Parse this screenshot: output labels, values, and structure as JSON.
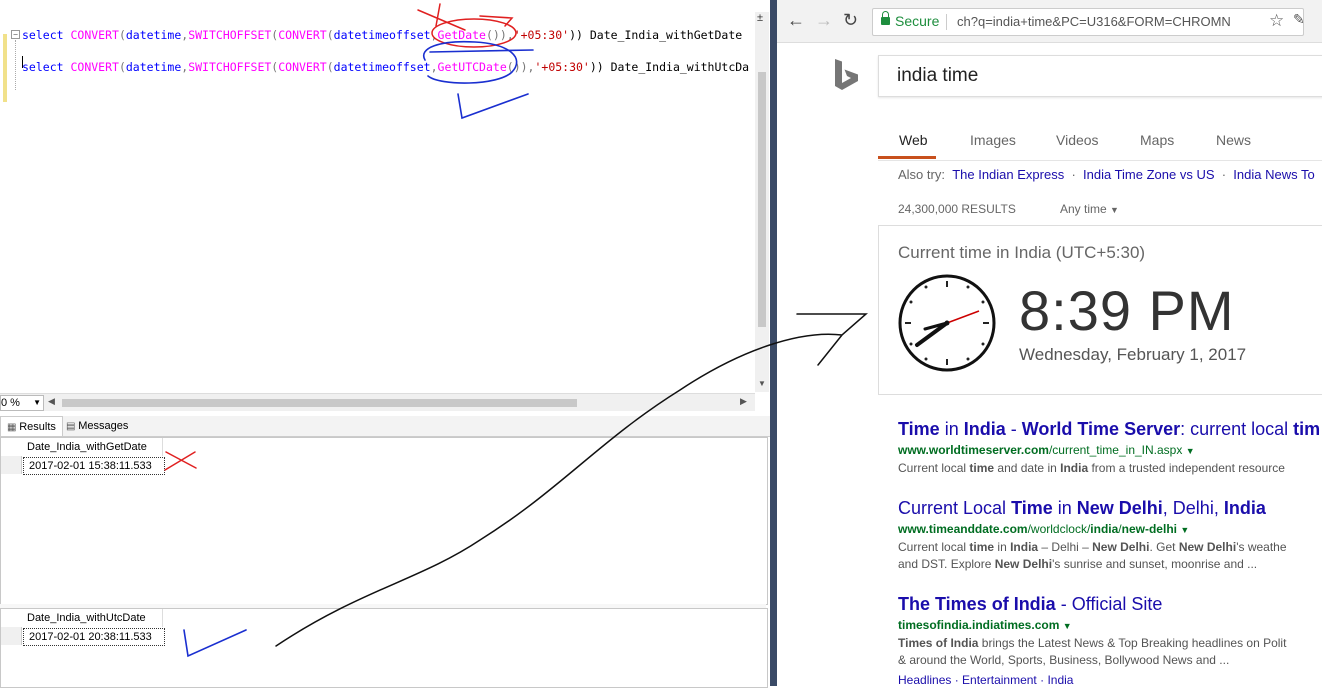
{
  "editor": {
    "line1": {
      "p1": "select ",
      "p2": "CONVERT",
      "p3": "(",
      "p4": "datetime",
      "p5": ",",
      "p6": "SWITCHOFFSET",
      "p7": "(",
      "p8": "CONVERT",
      "p9": "(",
      "p10": "datetimeoffset",
      "p11": ",",
      "p12": "GetDate",
      "p13": "()),",
      "p14": "'+05:30'",
      "p15": ")) Date_India_withGetDate"
    },
    "line2": {
      "p1": "select ",
      "p2": "CONVERT",
      "p3": "(",
      "p4": "datetime",
      "p5": ",",
      "p6": "SWITCHOFFSET",
      "p7": "(",
      "p8": "CONVERT",
      "p9": "(",
      "p10": "datetimeoffset",
      "p11": ",",
      "p12": "GetUTCDate",
      "p13": "()),",
      "p14": "'+05:30'",
      "p15": ")) Date_India_withUtcDa"
    },
    "zoom": "0 %"
  },
  "results": {
    "tabs": [
      "Results",
      "Messages"
    ],
    "grid1": {
      "header": "Date_India_withGetDate",
      "value": "2017-02-01 15:38:11.533"
    },
    "grid2": {
      "header": "Date_India_withUtcDate",
      "value": "2017-02-01 20:38:11.533"
    }
  },
  "browser": {
    "secure_label": "Secure",
    "url": "ch?q=india+time&PC=U316&FORM=CHROMN",
    "search_query": "india time",
    "scopes": [
      "Web",
      "Images",
      "Videos",
      "Maps",
      "News"
    ],
    "also_try_label": "Also try:",
    "also_try": [
      "The Indian Express",
      "India Time Zone vs US",
      "India News To"
    ],
    "result_count": "24,300,000 RESULTS",
    "any_time": "Any time",
    "time_card": {
      "title": "Current time in India (UTC+5:30)",
      "time": "8:39 PM",
      "date": "Wednesday, February 1, 2017"
    },
    "results": [
      {
        "title_parts": [
          "Time",
          " in ",
          "India",
          " - ",
          "World Time Server",
          ": current local ",
          "tim"
        ],
        "url_parts": [
          "www.worldtimeserver.com",
          "/current_time_in_IN.aspx"
        ],
        "desc1_parts": [
          "Current local ",
          "time",
          " and date in ",
          "India",
          " from a trusted independent resource"
        ]
      },
      {
        "title_parts": [
          "Current Local ",
          "Time",
          " in ",
          "New Delhi",
          ", Delhi, ",
          "India"
        ],
        "url_parts": [
          "www.timeanddate.com",
          "/worldclock/",
          "india",
          "/",
          "new-delhi"
        ],
        "desc1_parts": [
          "Current local ",
          "time",
          " in ",
          "India",
          " – Delhi – ",
          "New Delhi",
          ". Get ",
          "New Delhi",
          "'s weathe"
        ],
        "desc2_parts": [
          "and DST. Explore ",
          "New Delhi",
          "'s sunrise and sunset, moonrise and ..."
        ]
      },
      {
        "title_parts": [
          "The Times of India",
          " - Official Site"
        ],
        "url_parts": [
          "timesofindia.indiatimes.com"
        ],
        "desc1_parts": [
          "Times of India",
          " brings the Latest News & Top Breaking headlines on Polit"
        ],
        "desc2_parts": [
          "& around the World, Sports, Business, Bollywood News and ..."
        ],
        "links": [
          "Headlines",
          "Entertainment",
          "India"
        ]
      }
    ]
  }
}
